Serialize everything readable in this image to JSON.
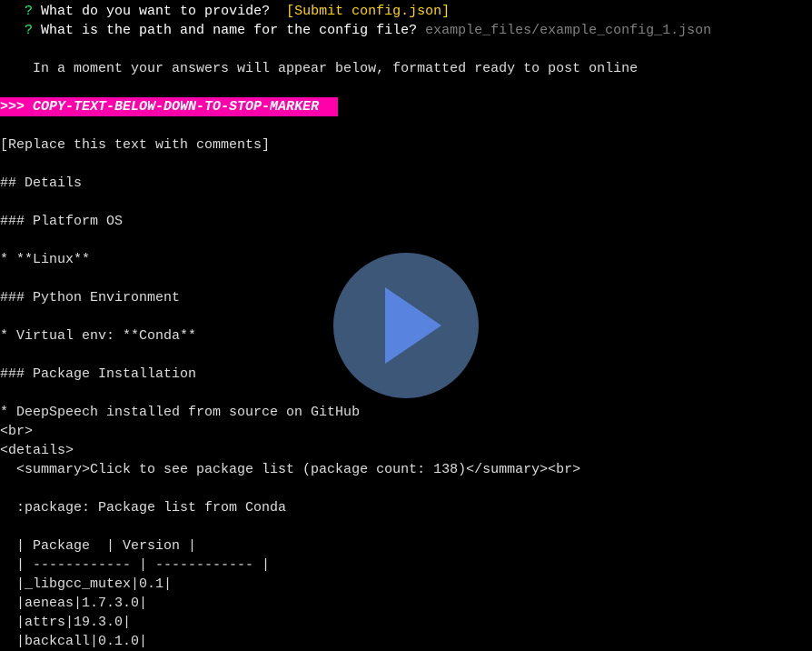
{
  "prompts": {
    "q1": {
      "marker": "?",
      "text": " What do you want to provide?  ",
      "answer": "[Submit config.json]"
    },
    "q2": {
      "marker": "?",
      "text": " What is the path and name for the config file? ",
      "answer": "example_files/example_config_1.json"
    }
  },
  "notice": "    In a moment your answers will appear below, formatted ready to post online",
  "marker": {
    "prefix": ">>> ",
    "text": "COPY-TEXT-BELOW-DOWN-TO-STOP-MARKER "
  },
  "body": {
    "l0": "[Replace this text with comments]",
    "l1": "## Details",
    "l2": "### Platform OS",
    "l3": "* **Linux**",
    "l4": "### Python Environment",
    "l5": "* Virtual env: **Conda**",
    "l6": "### Package Installation",
    "l7": "* DeepSpeech installed from source on GitHub",
    "l8": "<br>",
    "l9": "<details>",
    "l10": "  <summary>Click to see package list (package count: 138)</summary><br>",
    "l11": "  :package: Package list from Conda",
    "l12": "  | Package  | Version |",
    "l13": "  | ------------ | ------------ |",
    "l14": "  |_libgcc_mutex|0.1|",
    "l15": "  |aeneas|1.7.3.0|",
    "l16": "  |attrs|19.3.0|",
    "l17": "  |backcall|0.1.0|"
  },
  "chart_data": {
    "type": "table",
    "title": "Package list from Conda",
    "package_count": 138,
    "columns": [
      "Package",
      "Version"
    ],
    "rows": [
      [
        "_libgcc_mutex",
        "0.1"
      ],
      [
        "aeneas",
        "1.7.3.0"
      ],
      [
        "attrs",
        "19.3.0"
      ],
      [
        "backcall",
        "0.1.0"
      ]
    ]
  }
}
